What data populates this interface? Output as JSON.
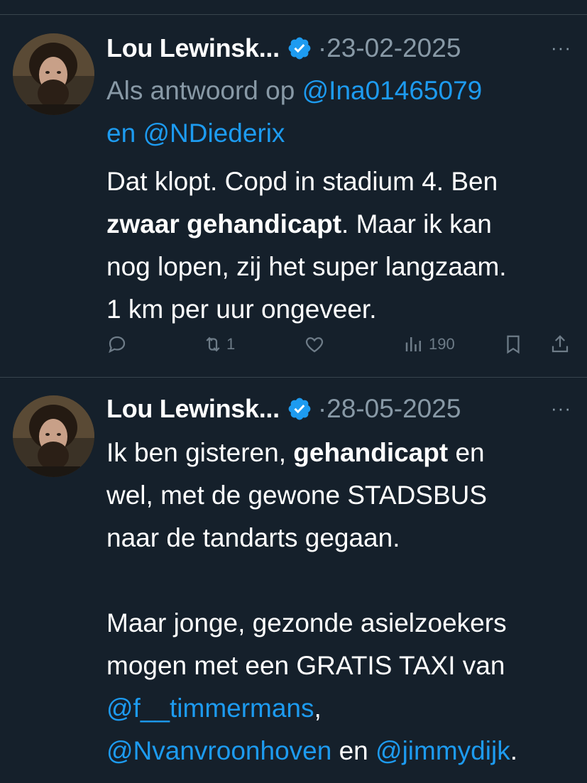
{
  "tweets": [
    {
      "name": "Lou Lewinsk...",
      "date": "23-02-2025",
      "more": "···",
      "reply_prefix": "Als antwoord op",
      "reply_mention_1": "@Ina01465079",
      "reply_and": "en",
      "reply_mention_2": "@NDiederix",
      "text_1": "Dat klopt. Copd in stadium 4. Ben",
      "text_bold": "zwaar gehandicapt",
      "text_2": ". Maar ik kan",
      "text_3": "nog lopen, zij het super langzaam.",
      "text_4": "1 km per uur ongeveer.",
      "retweets": "1",
      "views": "190",
      "icons": [
        "reply-icon",
        "retweet-icon",
        "like-icon",
        "views-icon",
        "bookmark-icon",
        "share-icon"
      ]
    },
    {
      "name": "Lou Lewinsk...",
      "date": "28-05-2025",
      "more": "···",
      "line1_a": "Ik ben gisteren, ",
      "line1_bold": "gehandicapt",
      "line1_b": " en",
      "line2": "wel, met de gewone STADSBUS",
      "line3": "naar de tandarts gegaan.",
      "line4": "Maar jonge, gezonde asielzoekers",
      "line5": "mogen met een GRATIS TAXI van",
      "mention_1": "@f__timmermans",
      "comma": ",",
      "mention_2": "@Nvanvroonhoven",
      "and": " en ",
      "mention_3": "@jimmydijk",
      "period": "."
    }
  ],
  "colors": {
    "background": "#15202b",
    "text": "#ffffff",
    "muted": "#8899a6",
    "link": "#1d9bf0",
    "divider": "#38444d"
  }
}
